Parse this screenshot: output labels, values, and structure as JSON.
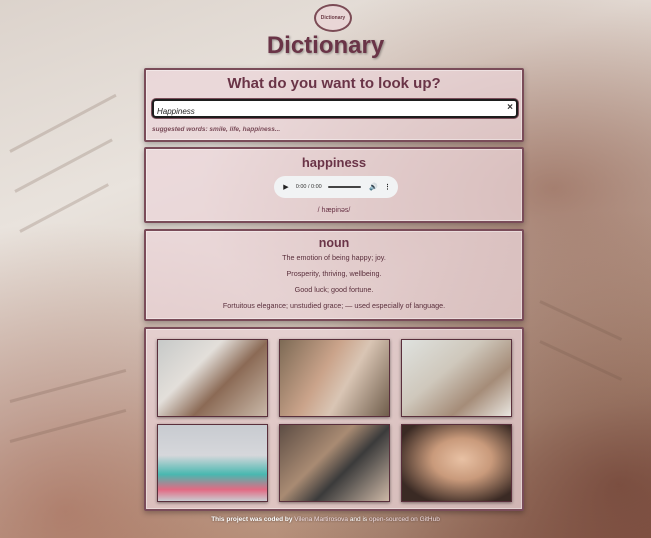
{
  "header": {
    "logo_text": "Dictionary",
    "title": "Dictionary"
  },
  "search": {
    "question": "What do you want to look up?",
    "value": "Happiness",
    "clear_icon": "clear-x-icon",
    "suggested": "suggested words: smile, life, happiness..."
  },
  "word": {
    "text": "happiness",
    "audio_time": "0:00 / 0:00",
    "phonetic": "/ hæpinəs/"
  },
  "meaning": {
    "part_of_speech": "noun",
    "definitions": [
      "The emotion of being happy; joy.",
      "Prosperity, thriving, wellbeing.",
      "Good luck; good fortune.",
      "Fortuitous elegance; unstudied grace; — used especially of language."
    ]
  },
  "images": [
    "photo-1",
    "photo-2",
    "photo-3",
    "photo-4",
    "photo-5",
    "photo-6"
  ],
  "footer": {
    "prefix": "This project was coded by",
    "author": "Vilena Martirosova",
    "middle": "and is",
    "link": "open-sourced on GitHub"
  },
  "colors": {
    "accent": "#6a3447",
    "card_border": "#7a4c59"
  }
}
